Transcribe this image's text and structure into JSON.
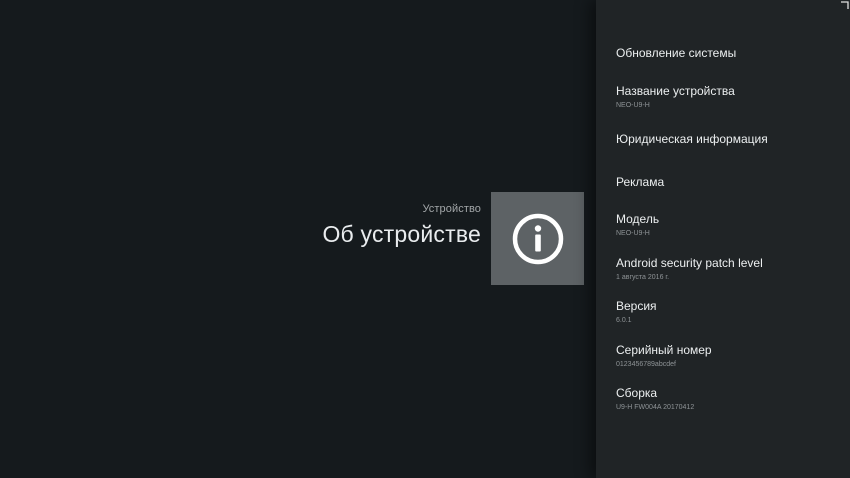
{
  "header": {
    "breadcrumb": "Устройство",
    "title": "Об устройстве",
    "icon": "info-icon"
  },
  "menu": {
    "items": [
      {
        "title": "Обновление системы",
        "subtitle": ""
      },
      {
        "title": "Название устройства",
        "subtitle": "NEO-U9-H"
      },
      {
        "title": "Юридическая информация",
        "subtitle": ""
      },
      {
        "title": "Реклама",
        "subtitle": ""
      },
      {
        "title": "Модель",
        "subtitle": "NEO-U9-H"
      },
      {
        "title": "Android security patch level",
        "subtitle": "1 августа 2016 г."
      },
      {
        "title": "Версия",
        "subtitle": "6.0.1"
      },
      {
        "title": "Серийный номер",
        "subtitle": "0123456789abcdef"
      },
      {
        "title": "Сборка",
        "subtitle": "U9-H FW004A 20170412"
      }
    ]
  },
  "colors": {
    "background": "#151a1d",
    "panel": "#202426",
    "icon_tile": "#5d6265"
  }
}
